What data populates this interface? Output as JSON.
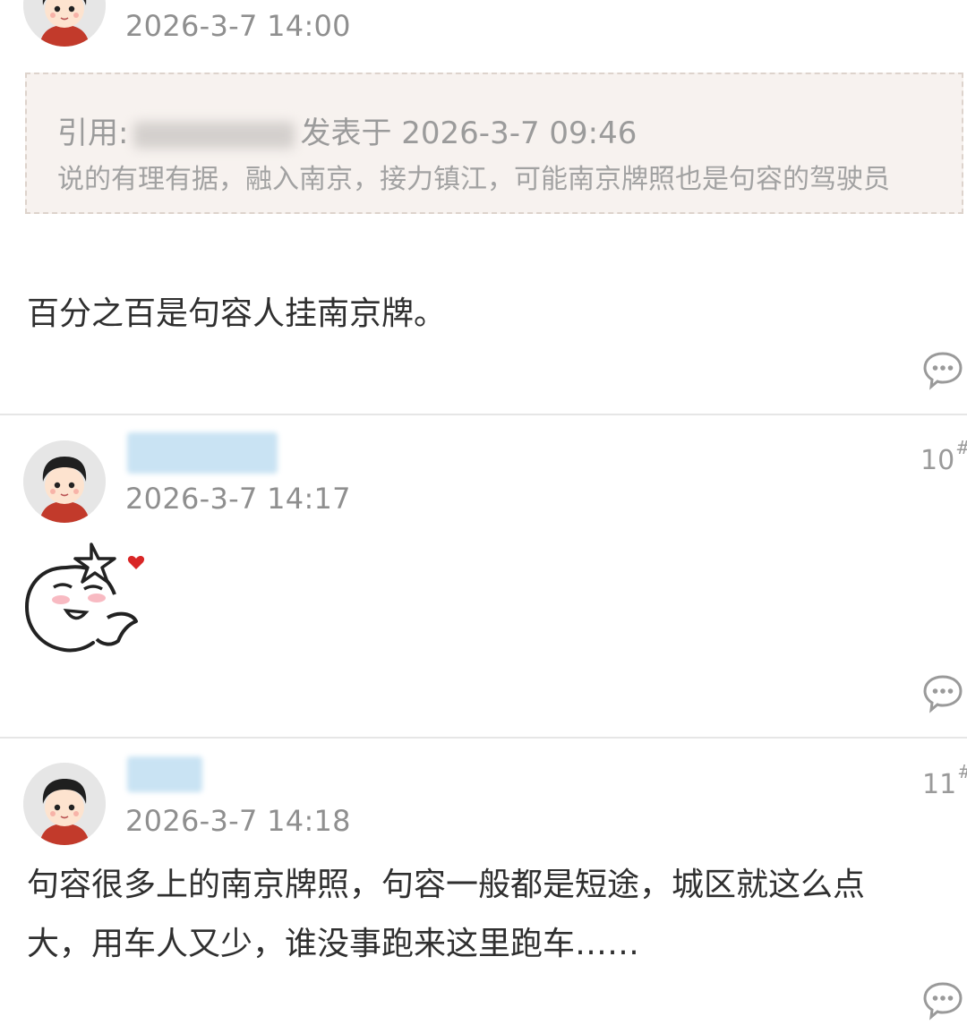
{
  "posts": [
    {
      "time": "2026-3-7 14:00",
      "quote": {
        "prefix": "引用:",
        "posted_label": "发表于 2026-3-7 09:46",
        "text": "说的有理有据，融入南京，接力镇江，可能南京牌照也是句容的驾驶员"
      },
      "content": "百分之百是句容人挂南京牌。"
    },
    {
      "time": "2026-3-7 14:17",
      "floor": "10",
      "floor_mark": "#",
      "sticker": "blushing-sticker"
    },
    {
      "time": "2026-3-7 14:18",
      "floor": "11",
      "floor_mark": "#",
      "content_line1": "句容很多上的南京牌照，句容一般都是短途，城区就这么点",
      "content_line2": "大，用车人又少，谁没事跑来这里跑车……"
    }
  ],
  "icons": {
    "reply": "speech-bubble-icon",
    "avatar": "default-avatar"
  },
  "colors": {
    "quote_bg": "#f7f2ef",
    "blur_name": "#c9e3f3",
    "text": "#2f2f2f",
    "meta": "#8f8f8f"
  }
}
